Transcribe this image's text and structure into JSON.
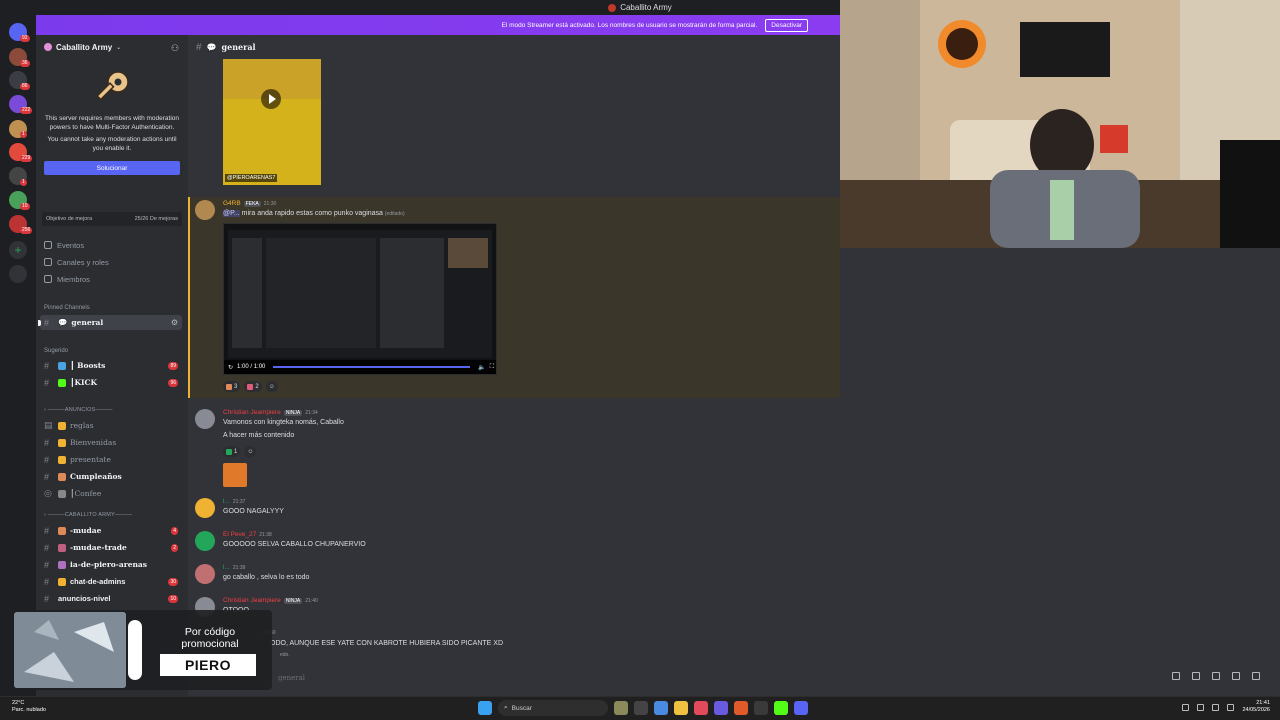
{
  "window": {
    "title": "Caballito Army"
  },
  "banner": {
    "text": "El modo Streamer está activado. Los nombres de usuario se mostrarán de forma parcial.",
    "button": "Desactivar"
  },
  "rail": {
    "badges": [
      "92",
      "36",
      "86",
      "222",
      "1",
      "229",
      "1",
      "10",
      "256"
    ]
  },
  "sidebar": {
    "server_name": "Caballito Army",
    "mfa": {
      "line1": "This server requires members with moderation powers to have Multi-Factor Authentication.",
      "line2": "You cannot take any moderation actions until you enable it.",
      "button": "Solucionar"
    },
    "boost_goal": {
      "label": "Objetivo de mejora",
      "progress": "25/26 De mejoras"
    },
    "nav": [
      "Eventos",
      "Canales y roles",
      "Miembros"
    ],
    "pinned_label": "Pinned Channels",
    "active_channel": "general",
    "suggested_label": "Sugerido",
    "suggested": [
      {
        "label": "┃ Boosts",
        "badge": "89"
      },
      {
        "label": "┃KICK",
        "badge": "96"
      }
    ],
    "cat_anuncios": "ANUNCIOS",
    "anuncios": [
      "reglas",
      "Bienvenidas",
      "presentate",
      "Cumpleaños",
      "┃Confee"
    ],
    "cat_army": "CABALLITO ARMY",
    "army": [
      {
        "label": "-mudae",
        "badge": "4"
      },
      {
        "label": "-mudae-trade",
        "badge": "2"
      },
      {
        "label": "ia-de-piero-arenas",
        "badge": ""
      },
      {
        "label": "chat-de-admins",
        "badge": "30"
      },
      {
        "label": "anuncios-nivel",
        "badge": "10"
      }
    ]
  },
  "chat": {
    "channel": "general",
    "video_caption": "@PIEROARENAS7",
    "messages": [
      {
        "user": "G4RB",
        "tag": "FEKA",
        "time": "21:30",
        "body": "mira anda rapido estas como punko vaginasa",
        "mention": "@P...",
        "edited": "(editado)"
      },
      {
        "user": "Christian Jeampiere",
        "tag": "NINJA",
        "time": "21:34",
        "line1": "Vamonos con kingteka nomás, Caballo",
        "line2": "A hacer más contenido"
      },
      {
        "user": "l...",
        "time": "21:37",
        "body": "GOOO NAGALYYY"
      },
      {
        "user": "El Peve_27",
        "time": "21:38",
        "body": "GOOOOO SELVA CABALLO CHUPANERVIO"
      },
      {
        "user": "l...",
        "time": "21:39",
        "body": "go caballo , selva lo es todo"
      },
      {
        "user": "Christian Jeampiere",
        "tag": "NINJA",
        "time": "21:40",
        "body": "OTOOO"
      },
      {
        "user": "",
        "time": "21:40",
        "body": "ODO, AUNQUE ESE YATE CON KABROTE HUBIERA SIDO PICANTE XD",
        "extra": "edo."
      }
    ],
    "video_time": "1:00 / 1:00",
    "reactions_1": [
      {
        "count": "3"
      },
      {
        "count": "2"
      }
    ],
    "reactions_2": [
      {
        "count": "1"
      }
    ],
    "composer_placeholder": "general"
  },
  "promo": {
    "line1": "Por código promocional",
    "code": "PIERO"
  },
  "taskbar": {
    "weather_temp": "22°C",
    "weather_desc": "Parc. nublado",
    "search": "Buscar",
    "time": "21:41",
    "date": "24/05/2026"
  }
}
